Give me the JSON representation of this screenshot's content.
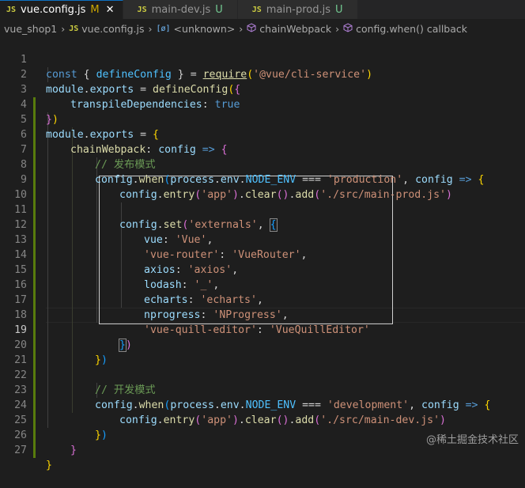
{
  "tabs": [
    {
      "icon": "JS",
      "name": "vue.config.js",
      "status": "M",
      "close": "✕",
      "active": true
    },
    {
      "icon": "JS",
      "name": "main-dev.js",
      "status": "U",
      "active": false
    },
    {
      "icon": "JS",
      "name": "main-prod.js",
      "status": "U",
      "active": false
    }
  ],
  "breadcrumb": {
    "folder": "vue_shop1",
    "file_icon": "JS",
    "file": "vue.config.js",
    "scope1_icon": "[ø]",
    "scope1": "<unknown>",
    "scope2": "chainWebpack",
    "scope3": "config.when() callback",
    "sep": "›"
  },
  "line_numbers": [
    "1",
    "2",
    "3",
    "4",
    "5",
    "6",
    "7",
    "8",
    "9",
    "10",
    "11",
    "12",
    "13",
    "14",
    "15",
    "16",
    "17",
    "18",
    "19",
    "20",
    "21",
    "22",
    "23",
    "24",
    "25",
    "26",
    "27"
  ],
  "code": {
    "l1": [
      "const",
      "{",
      "defineConfig",
      "}",
      "=",
      "require",
      "(",
      "'@vue/cli-service'",
      ")"
    ],
    "l2": [
      "module",
      ".",
      "exports",
      "=",
      "defineConfig",
      "(",
      "{"
    ],
    "l3": [
      "transpileDependencies",
      ":",
      "true"
    ],
    "l4": [
      "}",
      ")"
    ],
    "l5": [
      "module",
      ".",
      "exports",
      "=",
      "{"
    ],
    "l6": [
      "chainWebpack",
      ":",
      "config",
      "=>",
      "{"
    ],
    "l7": "// 发布模式",
    "l8": [
      "config",
      ".",
      "when",
      "(",
      "process",
      ".",
      "env",
      ".",
      "NODE_ENV",
      "===",
      "'production'",
      ",",
      "config",
      "=>",
      "{"
    ],
    "l9": [
      "config",
      ".",
      "entry",
      "(",
      "'app'",
      ")",
      ".",
      "clear",
      "()",
      ".",
      "add",
      "(",
      "'./src/main-prod.js'",
      ")"
    ],
    "l11": [
      "config",
      ".",
      "set",
      "(",
      "'externals'",
      ",",
      "{"
    ],
    "l12": [
      "vue",
      ":",
      "'Vue'",
      ","
    ],
    "l13": [
      "'vue-router'",
      ":",
      "'VueRouter'",
      ","
    ],
    "l14": [
      "axios",
      ":",
      "'axios'",
      ","
    ],
    "l15": [
      "lodash",
      ":",
      "'_'",
      ","
    ],
    "l16": [
      "echarts",
      ":",
      "'echarts'",
      ","
    ],
    "l17": [
      "nprogress",
      ":",
      "'NProgress'",
      ","
    ],
    "l18": [
      "'vue-quill-editor'",
      ":",
      "'VueQuillEditor'"
    ],
    "l19": [
      "}",
      ")"
    ],
    "l20": [
      "}",
      ")"
    ],
    "l22": "// 开发模式",
    "l23": [
      "config",
      ".",
      "when",
      "(",
      "process",
      ".",
      "env",
      ".",
      "NODE_ENV",
      "===",
      "'development'",
      ",",
      "config",
      "=>",
      "{"
    ],
    "l24": [
      "config",
      ".",
      "entry",
      "(",
      "'app'",
      ")",
      ".",
      "clear",
      "()",
      ".",
      "add",
      "(",
      "'./src/main-dev.js'",
      ")"
    ],
    "l25": [
      "}",
      ")"
    ],
    "l26": "}",
    "l27": "}"
  },
  "watermark": "@稀土掘金技术社区",
  "colors": {
    "keyword": "#569cd6",
    "function": "#dcdcaa",
    "variable": "#9cdcfe",
    "string": "#ce9178",
    "comment": "#6a9955",
    "constant": "#4fc1ff",
    "bracket": "#ffd700"
  }
}
